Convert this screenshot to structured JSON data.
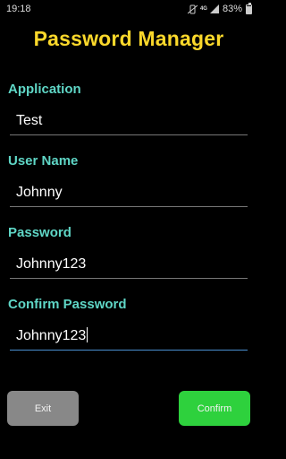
{
  "status_bar": {
    "time": "19:18",
    "network": "4G",
    "battery_percent": "83%"
  },
  "header": {
    "title": "Password Manager"
  },
  "form": {
    "application": {
      "label": "Application",
      "value": "Test"
    },
    "user_name": {
      "label": "User Name",
      "value": "Johnny"
    },
    "password": {
      "label": "Password",
      "value": "Johnny123"
    },
    "confirm_password": {
      "label": "Confirm Password",
      "value": "Johnny123"
    }
  },
  "buttons": {
    "exit_label": "Exit",
    "confirm_label": "Confirm"
  },
  "colors": {
    "title": "#fbd82b",
    "label": "#5fd6c6",
    "exit_button": "#888888",
    "confirm_button": "#2ed13d",
    "focus_underline": "#4a8fd0"
  }
}
